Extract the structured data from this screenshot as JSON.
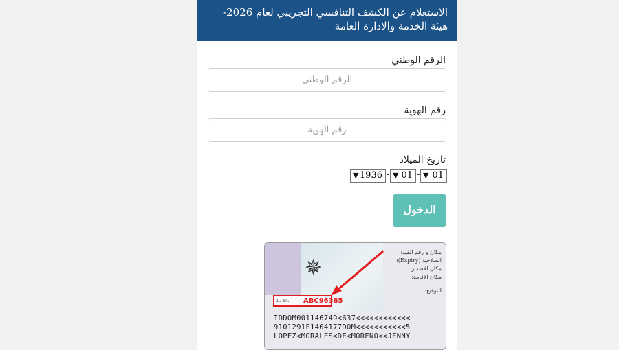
{
  "header": {
    "title": "الاستعلام عن الكشف التنافسي التجريبي لعام 2026-هيئة الخدمة والادارة العامة"
  },
  "form": {
    "national_id": {
      "label": "الرقم الوطني",
      "placeholder": "الرقم الوطني"
    },
    "id_number": {
      "label": "رقم الهوية",
      "placeholder": "رقم الهوية"
    },
    "dob": {
      "label": "تاريخ الميلاد",
      "day": "01",
      "month": "01",
      "year": "1936",
      "separator": "-"
    },
    "login_button": "الدخول"
  },
  "id_card": {
    "fields": [
      "مكان و رقم القيد:",
      "الصلاحية (Expiry):",
      "مكان الاصدار:",
      "مكان الاقامة:",
      "التوقيع:"
    ],
    "id_label": "ID no.",
    "id_number": "ABC96385",
    "mrz": [
      "IDDOM001146749<637<<<<<<<<<<<<",
      "9101291F1404177DOM<<<<<<<<<<<5",
      "LOPEZ<MORALES<DE<MORENO<<JENNY"
    ]
  },
  "colors": {
    "header_bg": "#1b5288",
    "button_bg": "#5fc0b6",
    "highlight": "#e01c1c"
  }
}
